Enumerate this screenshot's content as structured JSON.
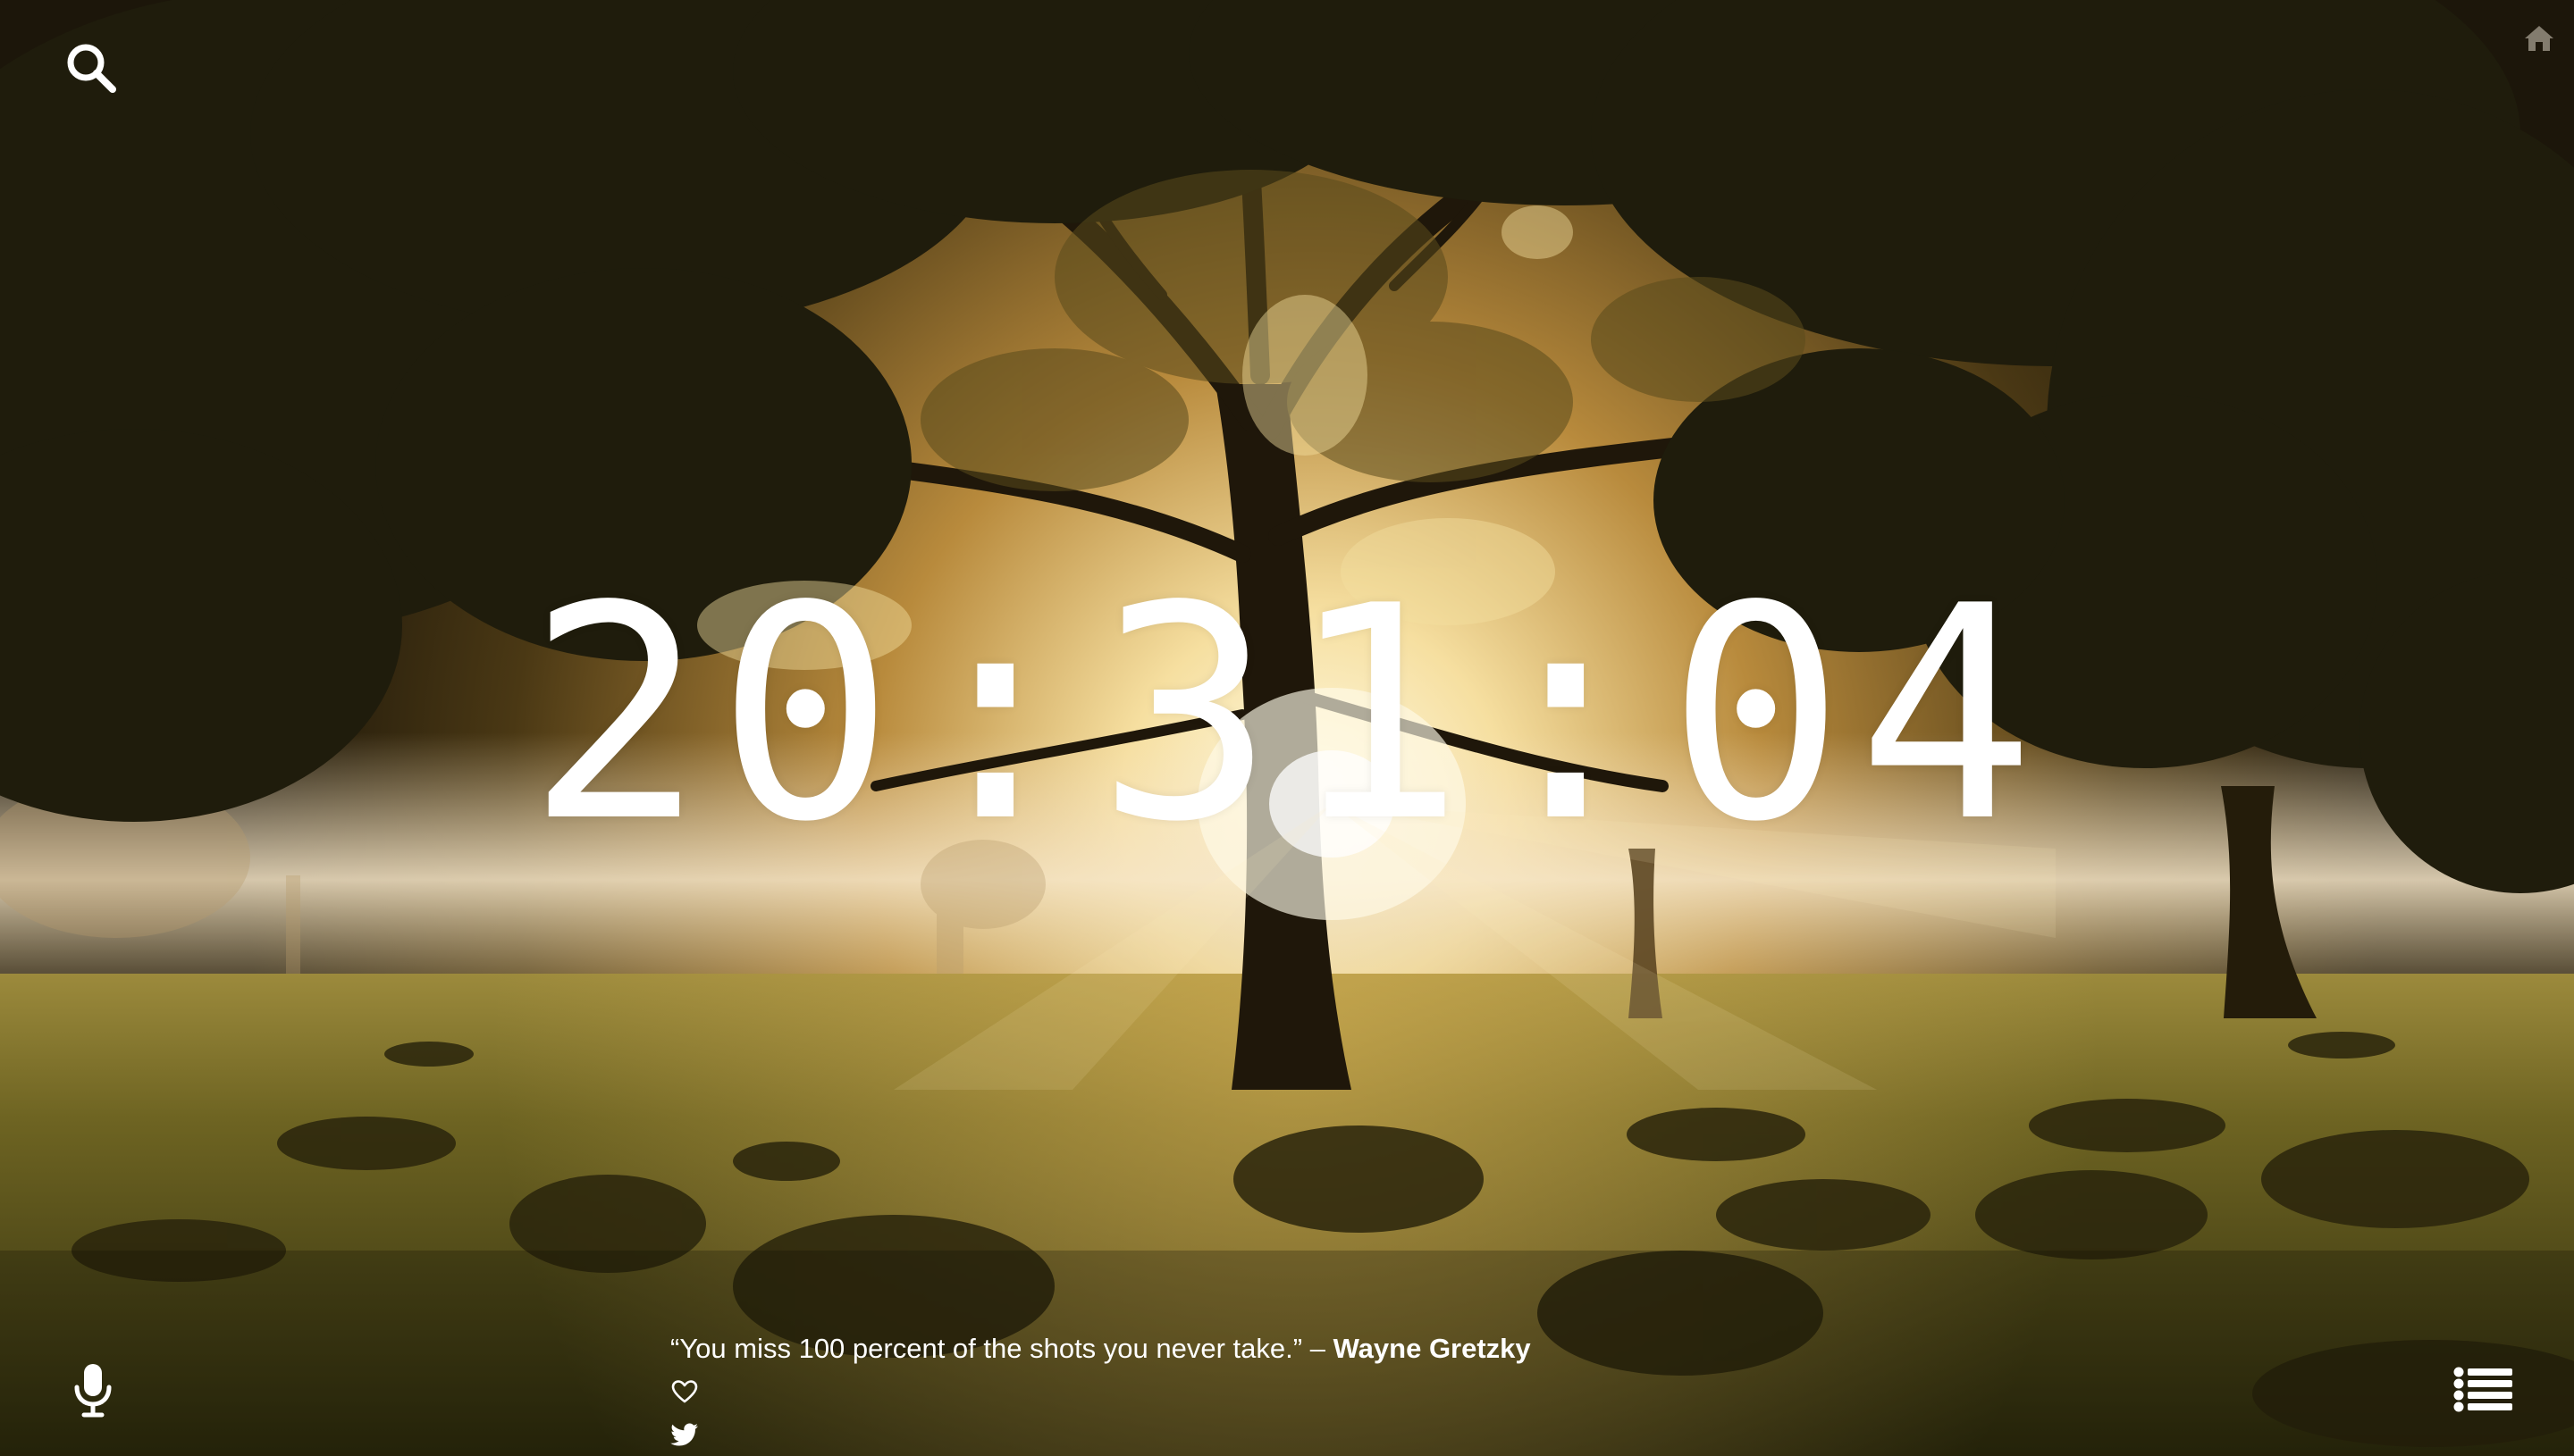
{
  "clock": {
    "time": "20:31:04"
  },
  "quote": {
    "text": "“You miss 100 percent of the shots you never take.” –",
    "author": "Wayne Gretzky"
  },
  "icons": {
    "search": "search-icon",
    "home": "home-icon",
    "mic": "microphone-icon",
    "list": "list-icon",
    "heart": "heart-icon",
    "twitter": "twitter-icon"
  },
  "colors": {
    "text": "#ffffff",
    "sun_glow": "#fff3c8",
    "grass": "#5a5418"
  }
}
